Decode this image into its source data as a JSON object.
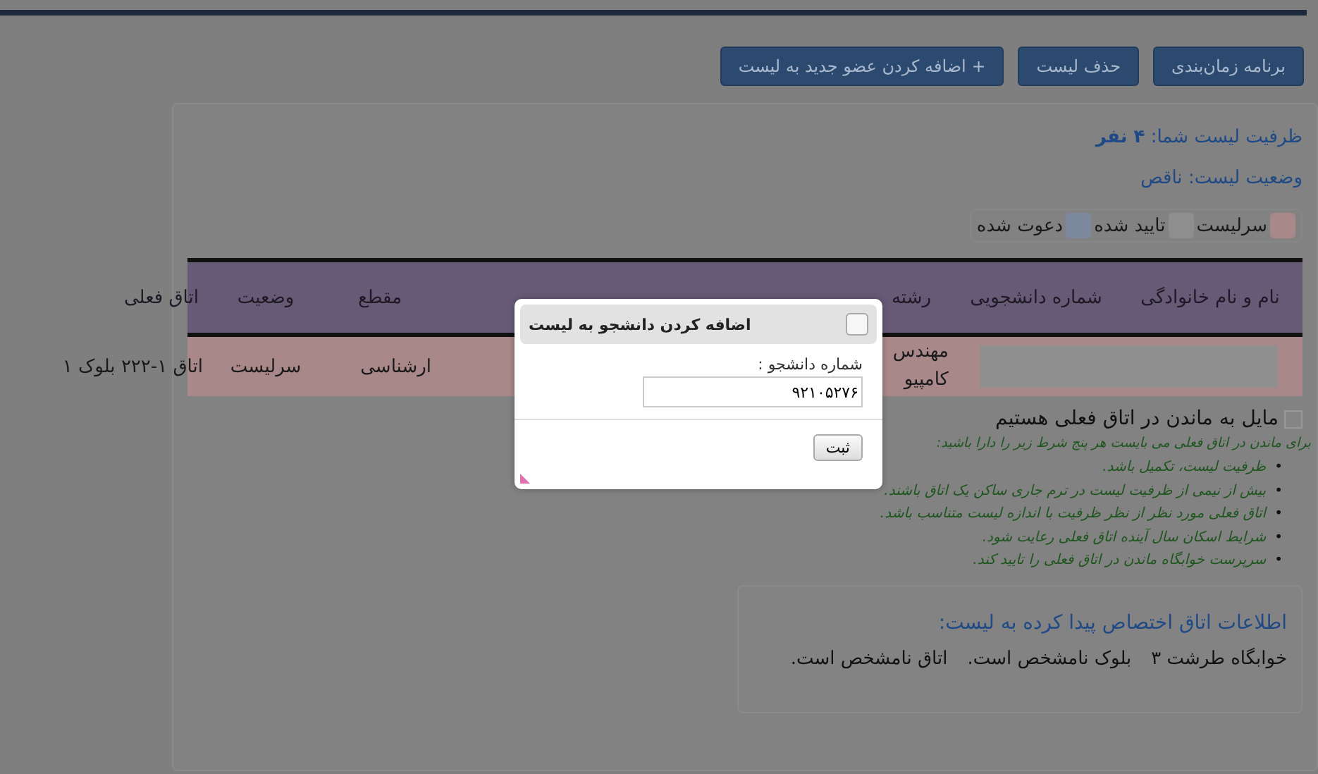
{
  "toolbar": {
    "buttons": [
      {
        "label": "برنامه زمان‌بندی"
      },
      {
        "label": "حذف لیست"
      },
      {
        "label": "+ اضافه کردن عضو جدید به لیست"
      }
    ]
  },
  "capacity": {
    "label": "ظرفیت لیست شما:",
    "value": "۴ نفر"
  },
  "status": {
    "label": "وضعیت لیست:",
    "value": "ناقص"
  },
  "legend": [
    {
      "label": "سرلیست",
      "color": "#a88888"
    },
    {
      "label": "تایید شده",
      "color": "#8e8e8e"
    },
    {
      "label": "دعوت شده",
      "color": "#7c889e"
    }
  ],
  "table": {
    "columns": [
      "نام و نام خانوادگی",
      "شماره دانشجویی",
      "رشته",
      "مقطع",
      "وضعیت",
      "اتاق فعلی"
    ],
    "rows": [
      {
        "color": "#a88888",
        "major": [
          "مهندس",
          "کامپیو"
        ],
        "level": "ارشناسی",
        "status": "سرلیست",
        "room": "اتاق ۱-۲۲۲ بلوک ۱"
      }
    ]
  },
  "stay": {
    "label": "مایل به ماندن در اتاق فعلی هستیم",
    "checked": false,
    "bullet": "•",
    "intro": "برای ماندن در اتاق فعلی می بایست هر پنج شرط زیر را دارا باشید:",
    "conditions": [
      "ظرفیت لیست، تکمیل باشد.",
      "بیش از نیمی از ظرفیت لیست در ترم جاری ساکن یک اتاق باشند.",
      "اتاق فعلی مورد نظر از نظر ظرفیت با اندازه لیست متناسب باشد.",
      "شرایط اسکان سال آینده اتاق فعلی رعایت شود.",
      "سرپرست خوابگاه ماندن در اتاق فعلی را تایید کند."
    ]
  },
  "allocation": {
    "title": "اطلاعات اتاق اختصاص پیدا کرده به لیست:",
    "parts": [
      "خوابگاه طرشت ۳",
      "بلوک نامشخص است.",
      "اتاق نامشخص است."
    ]
  },
  "dialog": {
    "title": "اضافه کردن دانشجو به لیست",
    "field_label": "شماره دانشجو :",
    "field_value": "۹۲۱۰۵۲۷۶",
    "submit": "ثبت"
  }
}
